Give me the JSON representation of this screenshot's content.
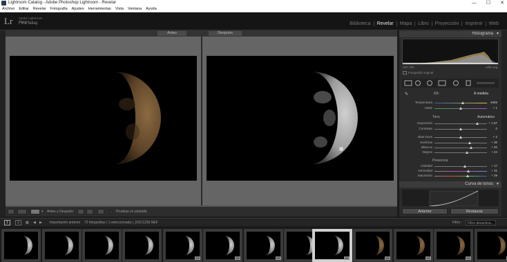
{
  "window": {
    "title": "Lightroom Catalog - Adobe Photoshop Lightroom - Revelar",
    "controls": [
      "—",
      "☐",
      "✕"
    ]
  },
  "menu": [
    "Archivo",
    "Editar",
    "Revelar",
    "Fotografía",
    "Ajustes",
    "Herramientas",
    "Vista",
    "Ventana",
    "Ayuda"
  ],
  "identity": {
    "logo": "Lr",
    "brand_top": "Adobe Lightroom",
    "brand_sub": "Classic",
    "plate": "Fina fatlay"
  },
  "modules": [
    "Biblioteca",
    "Revelar",
    "Mapa",
    "Libro",
    "Proyección",
    "Imprimir",
    "Web"
  ],
  "active_module": "Revelar",
  "view": {
    "before_label": "Antes",
    "after_label": "Después"
  },
  "toolbar": {
    "mode_label": "Antes y Después:",
    "soft_proof": "Pruebas en pantalla"
  },
  "histogram": {
    "title": "Histograma",
    "iso": "ISO 100",
    "focal": "1/30 seg",
    "original": "Fotografía original"
  },
  "basic": {
    "wb_label": "EB :",
    "wb_value": "A medida",
    "temp": {
      "label": "Temperatura",
      "value": "4905",
      "pos": 0.55
    },
    "tint": {
      "label": "Matiz",
      "value": "+ 1",
      "pos": 0.5
    },
    "tone_label": "Tono",
    "auto_label": "Automático",
    "exposure": {
      "label": "Exposición",
      "value": "+ 1,97",
      "pos": 0.82
    },
    "contrast": {
      "label": "Contraste",
      "value": "0",
      "pos": 0.5
    },
    "highlights": {
      "label": "Altas luces",
      "value": "+ 2",
      "pos": 0.51
    },
    "shadows": {
      "label": "Sombras",
      "value": "+ 36",
      "pos": 0.68
    },
    "whites": {
      "label": "Blancos",
      "value": "+ 40",
      "pos": 0.7
    },
    "blacks": {
      "label": "Negros",
      "value": "+ 24",
      "pos": 0.62
    },
    "presence_label": "Presencia",
    "clarity": {
      "label": "Claridad",
      "value": "+ 17",
      "pos": 0.58
    },
    "vibrance": {
      "label": "Intensidad",
      "value": "+ 31",
      "pos": 0.65
    },
    "saturation": {
      "label": "Saturación",
      "value": "+ 29",
      "pos": 0.64
    }
  },
  "curve": {
    "title": "Curva de tonos"
  },
  "buttons": {
    "previous": "Anterior",
    "reset": "Restaurar"
  },
  "filmstrip": {
    "screen1": "1",
    "screen2": "2",
    "source": "Importación anterior",
    "count": "72 fotografías / 1 seleccionada /_DSC1236.NEF",
    "filter_label": "Filtro :",
    "filter_value": "Filtro desactiva..."
  },
  "colors": {
    "accent": "#d8d8d8",
    "sepia": "#6b5030"
  }
}
